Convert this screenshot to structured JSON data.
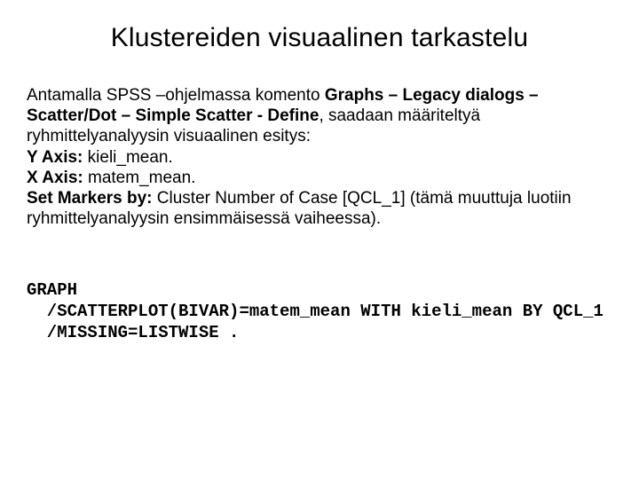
{
  "title": "Klustereiden visuaalinen tarkastelu",
  "body": {
    "r1a": "Antamalla SPSS –ohjelmassa komento ",
    "r1b": "Graphs – Legacy dialogs – Scatter/Dot – Simple Scatter - Define",
    "r1c": ", saadaan määriteltyä ryhmittelyanalyysin visuaalinen esitys:",
    "yaxis_label": "Y Axis:",
    "yaxis_value": " kieli_mean.",
    "xaxis_label": "X Axis:",
    "xaxis_value": " matem_mean.",
    "markers_label": "Set Markers by:",
    "markers_value": " Cluster Number of Case [QCL_1] (tämä muuttuja luotiin ryhmittelyanalyysin ensimmäisessä vaiheessa)."
  },
  "code": {
    "l1": "GRAPH",
    "l2": "  /SCATTERPLOT(BIVAR)=matem_mean WITH kieli_mean BY QCL_1",
    "l3": "  /MISSING=LISTWISE ."
  }
}
